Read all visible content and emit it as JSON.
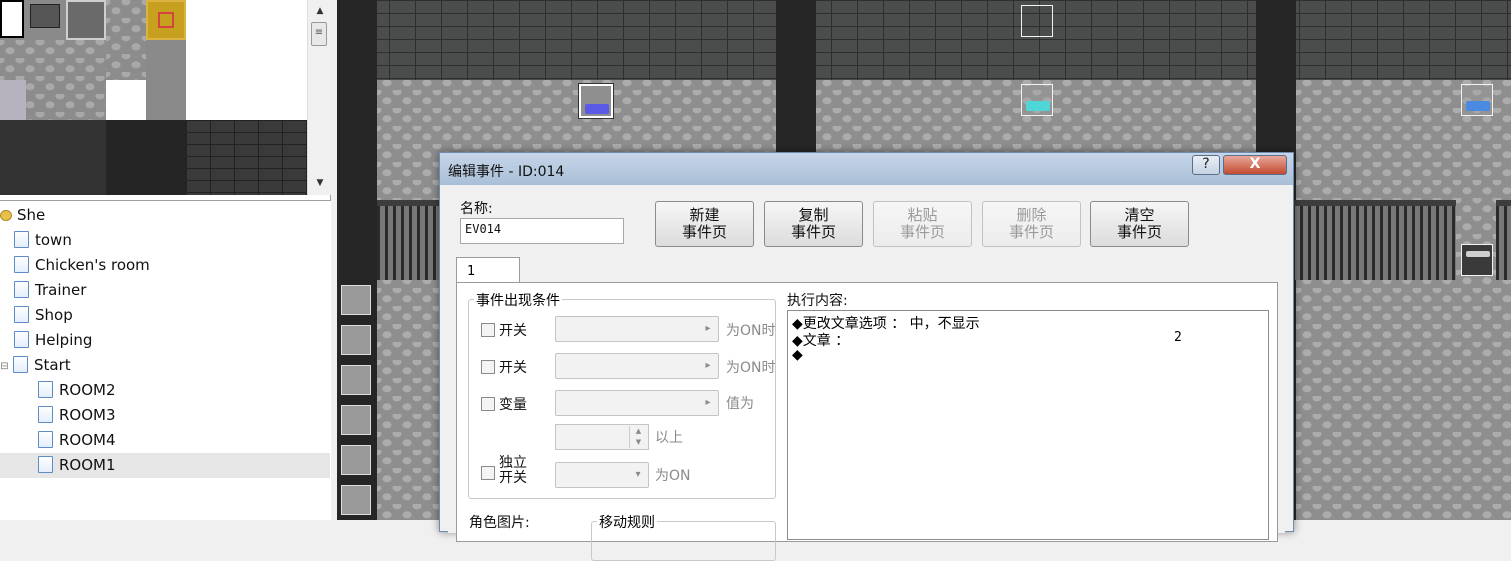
{
  "tileset": {
    "scroll_up": "▲",
    "scroll_down": "▼",
    "scroll_thumb": "≡"
  },
  "map_tree": {
    "root": "She",
    "items": [
      "town",
      "Chicken's room",
      "Trainer",
      "Shop",
      "Helping"
    ],
    "start": "Start",
    "start_children": [
      "ROOM2",
      "ROOM3",
      "ROOM4",
      "ROOM1"
    ],
    "expander": "⊟"
  },
  "dialog": {
    "title": "编辑事件 - ID:014",
    "help": "?",
    "close": "X",
    "name_label": "名称:",
    "name_value": "EV014",
    "buttons": {
      "new_page": [
        "新建",
        "事件页"
      ],
      "copy_page": [
        "复制",
        "事件页"
      ],
      "paste_page": [
        "粘贴",
        "事件页"
      ],
      "delete_page": [
        "删除",
        "事件页"
      ],
      "clear_page": [
        "清空",
        "事件页"
      ]
    },
    "tab": "1",
    "conditions": {
      "title": "事件出现条件",
      "switch1": "开关",
      "switch2": "开关",
      "variable": "变量",
      "self_switch": [
        "独立",
        "开关"
      ],
      "when_on1": "为ON时",
      "when_on2": "为ON时",
      "value_is": "值为",
      "above": "以上",
      "is_on": "为ON"
    },
    "image_label": "角色图片:",
    "move_rule": "移动规则",
    "contents": {
      "label": "执行内容:",
      "lines": [
        "◆更改文章选项 ： 中，不显示",
        "◆文章 ：",
        "◆"
      ],
      "line2_value": "2"
    }
  },
  "colors": {
    "event_blue": "#5a5ae6",
    "event_cyan": "#4fd6d6",
    "event_blue2": "#4a8ae0",
    "close_red": "#c24b32"
  }
}
